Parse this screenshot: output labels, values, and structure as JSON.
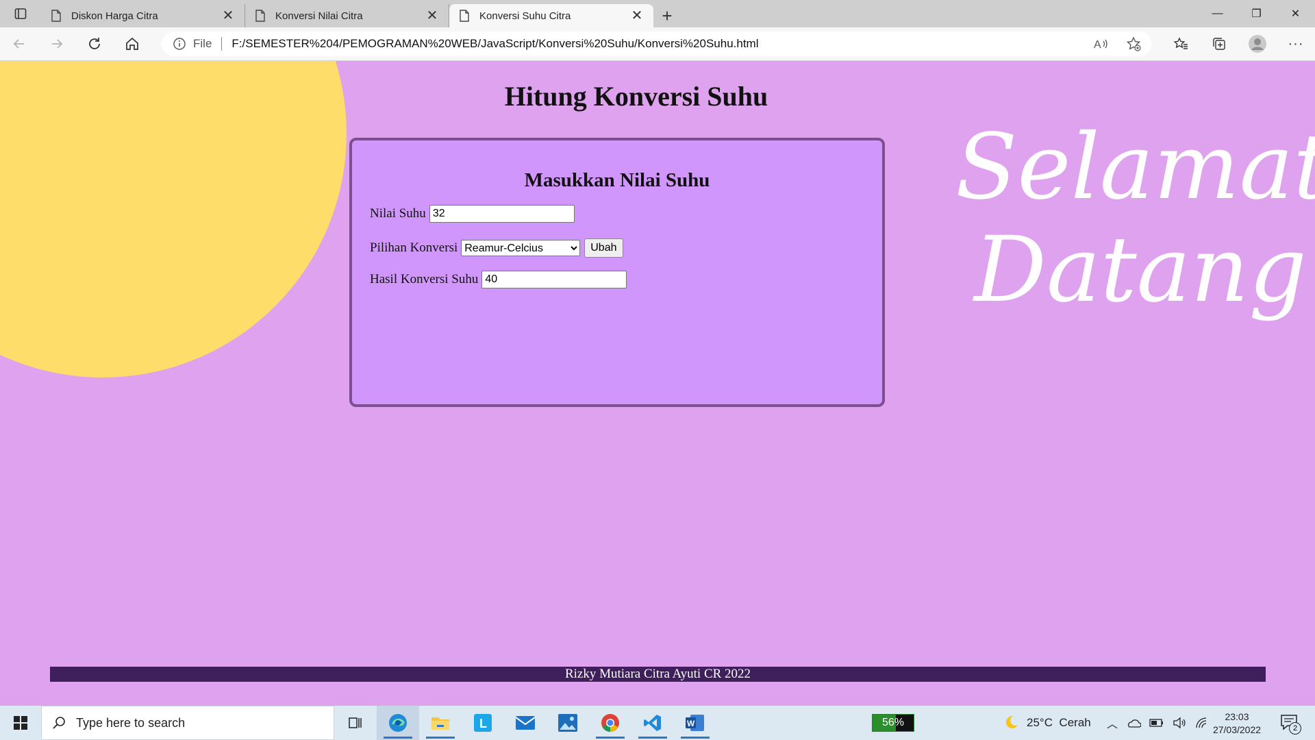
{
  "browser": {
    "tabs": [
      {
        "title": "Diskon Harga Citra",
        "active": false
      },
      {
        "title": "Konversi Nilai Citra",
        "active": false
      },
      {
        "title": "Konversi Suhu Citra",
        "active": true
      }
    ],
    "address": {
      "scheme_label": "File",
      "url": "F:/SEMESTER%204/PEMOGRAMAN%20WEB/JavaScript/Konversi%20Suhu/Konversi%20Suhu.html"
    }
  },
  "page": {
    "title": "Hitung Konversi Suhu",
    "welcome_line1": "Selamat",
    "welcome_line2": "Datang",
    "form": {
      "heading": "Masukkan Nilai Suhu",
      "nilai_label": "Nilai Suhu",
      "nilai_value": "32",
      "pilihan_label": "Pilihan Konversi",
      "pilihan_selected": "Reamur-Celcius",
      "button_label": "Ubah",
      "hasil_label": "Hasil Konversi Suhu",
      "hasil_value": "40"
    },
    "footer": "Rizky Mutiara Citra Ayuti CR 2022",
    "colors": {
      "background": "#dfa2ee",
      "panel": "#d196fb",
      "sun": "#fedd6a",
      "footer": "#3e1f5c"
    }
  },
  "taskbar": {
    "search_placeholder": "Type here to search",
    "battery_percent": "56%",
    "battery_level": 0.56,
    "weather": "25°C  Cerah",
    "time": "23:03",
    "date": "27/03/2022",
    "notification_count": "2",
    "apps": [
      "task-view",
      "edge",
      "file-explorer",
      "lark",
      "mail",
      "photos",
      "chrome",
      "vscode",
      "word"
    ]
  }
}
